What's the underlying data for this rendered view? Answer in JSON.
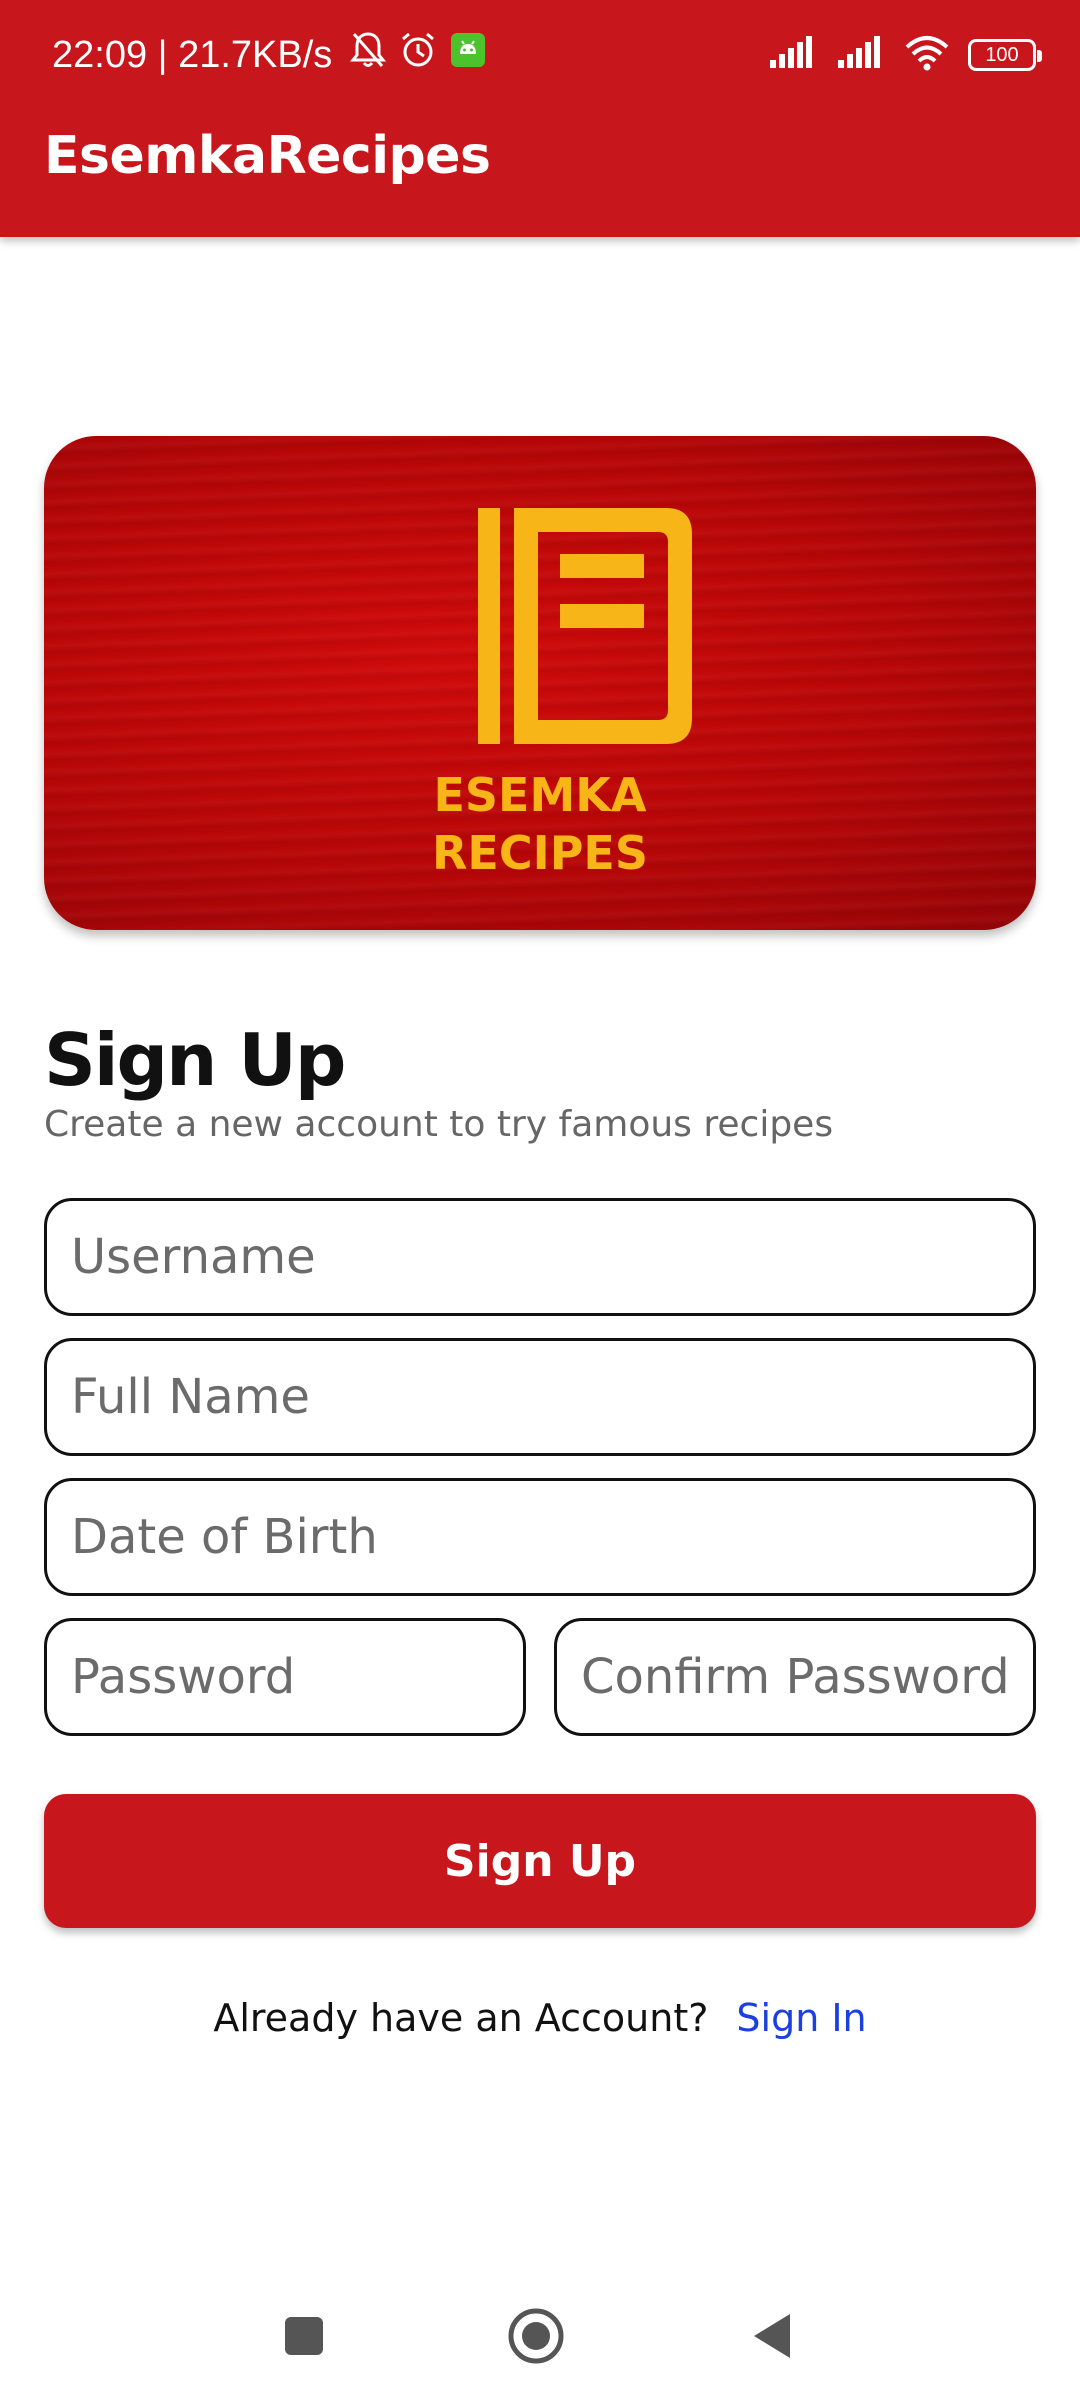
{
  "status_bar": {
    "time_speed": "22:09 | 21.7KB/s",
    "battery": "100",
    "icons": [
      "mute-bell-icon",
      "alarm-icon",
      "android-app-icon",
      "signal-icon",
      "signal-icon",
      "wifi-icon",
      "battery-icon"
    ]
  },
  "app_bar": {
    "title": "EsemkaRecipes"
  },
  "banner": {
    "line1": "ESEMKA",
    "line2": "RECIPES",
    "accent_color": "#f7b518",
    "background_color": "#c00808"
  },
  "form": {
    "title": "Sign Up",
    "subtitle": "Create a new account to try famous recipes",
    "username_placeholder": "Username",
    "fullname_placeholder": "Full Name",
    "dob_placeholder": "Date of Birth",
    "password_placeholder": "Password",
    "confirm_password_placeholder": "Confirm Password",
    "submit_label": "Sign Up"
  },
  "footer": {
    "question": "Already have an Account?",
    "signin_label": "Sign In"
  },
  "nav": {
    "icons": [
      "recents-square-icon",
      "home-circle-icon",
      "back-triangle-icon"
    ]
  },
  "colors": {
    "primary": "#c8161d",
    "link": "#1c3fe0"
  }
}
